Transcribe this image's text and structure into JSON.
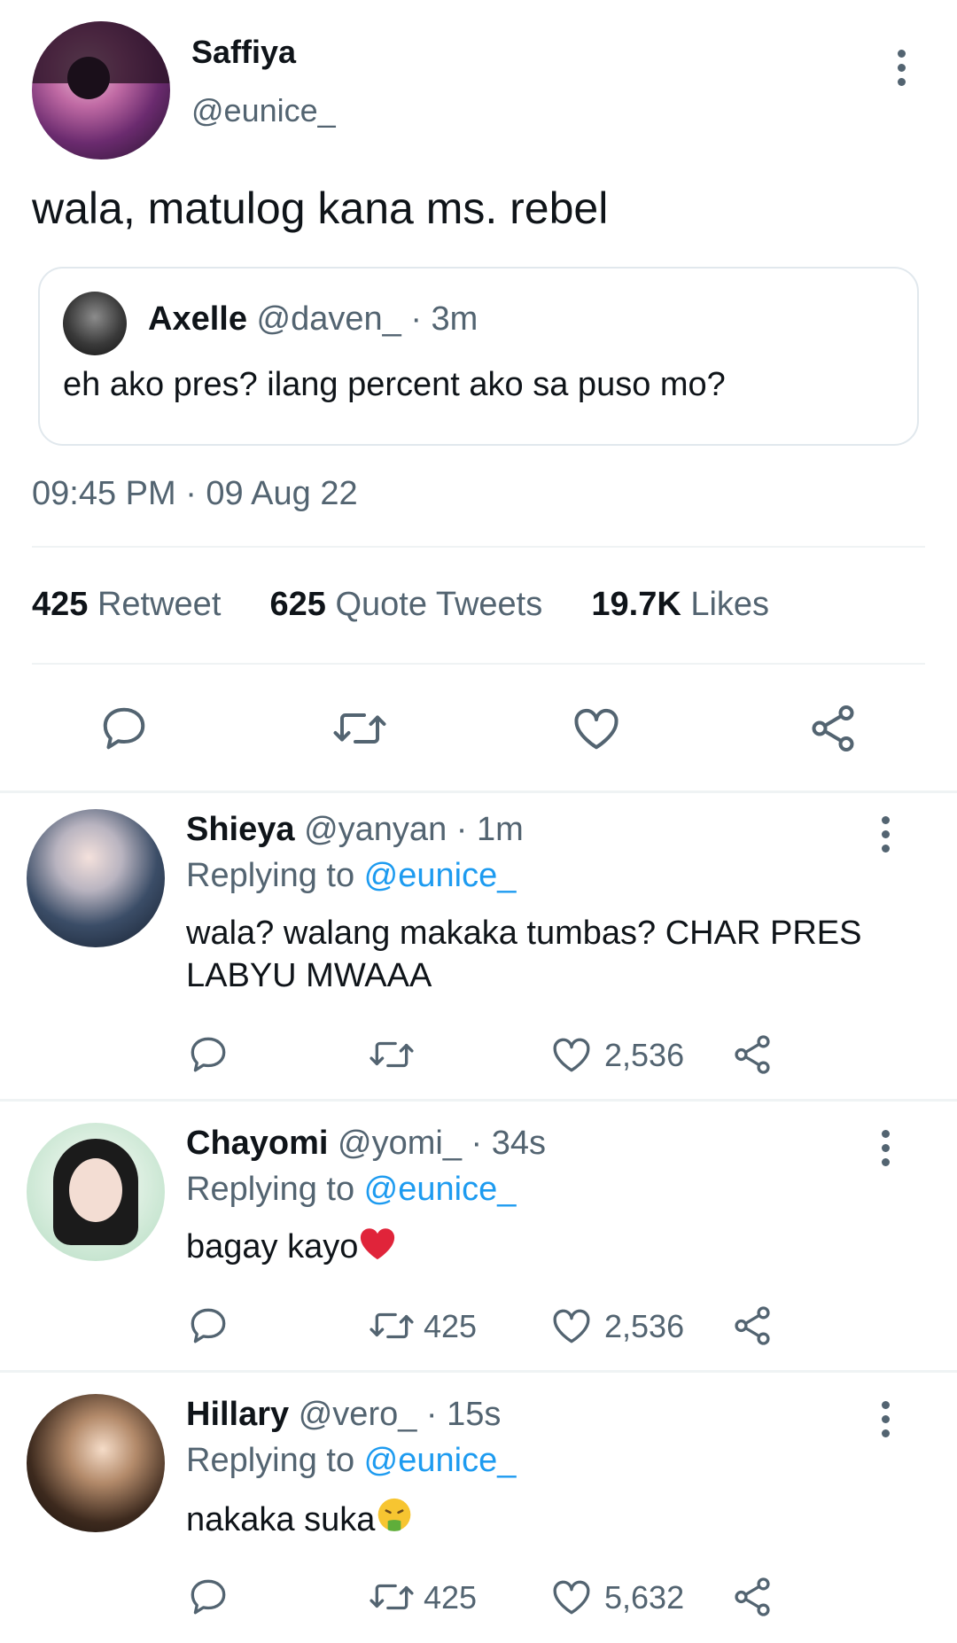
{
  "main_tweet": {
    "author_name": "Saffiya",
    "author_handle": "@eunice_",
    "text": "wala, matulog kana ms. rebel",
    "quoted": {
      "author_name": "Axelle",
      "author_meta": "@daven_ · 3m",
      "text": "eh ako pres? ilang percent ako sa puso mo?"
    },
    "timestamp": "09:45 PM · 09 Aug 22",
    "stats": {
      "retweets": "425",
      "retweets_label": "Retweet",
      "quotes": "625",
      "quotes_label": "Quote Tweets",
      "likes": "19.7K",
      "likes_label": "Likes"
    },
    "actions": [
      "reply-icon",
      "retweet-icon",
      "like-icon",
      "share-icon"
    ]
  },
  "replies": [
    {
      "name": "Shieya",
      "meta": "@yanyan · 1m",
      "replying_prefix": "Replying to ",
      "replying_to": "@eunice_",
      "text": "wala? walang makaka tumbas? CHAR PRES LABYU MWAAA",
      "retweets": "",
      "likes": "2,536"
    },
    {
      "name": "Chayomi",
      "meta": "@yomi_ · 34s",
      "replying_prefix": "Replying to ",
      "replying_to": "@eunice_",
      "text": "bagay kayo",
      "emoji": "red-heart",
      "retweets": "425",
      "likes": "2,536"
    },
    {
      "name": "Hillary",
      "meta": "@vero_ · 15s",
      "replying_prefix": "Replying to ",
      "replying_to": "@eunice_",
      "text": "nakaka suka",
      "emoji": "vomiting-face",
      "retweets": "425",
      "likes": "5,632"
    }
  ],
  "colors": {
    "text_primary": "#0f1419",
    "text_secondary": "#536471",
    "link": "#1d9bf0",
    "divider": "#eff3f4"
  }
}
